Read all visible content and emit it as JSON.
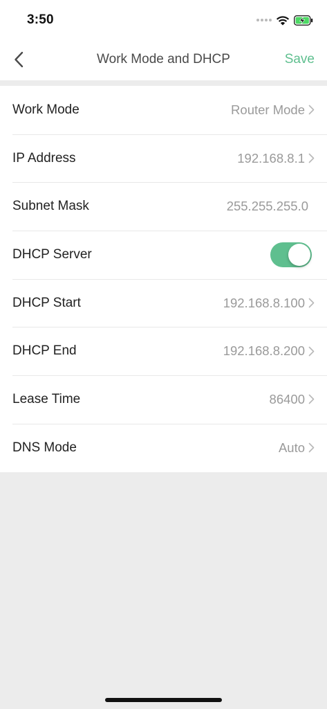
{
  "status_bar": {
    "time": "3:50"
  },
  "nav": {
    "title": "Work Mode and DHCP",
    "save_label": "Save"
  },
  "colors": {
    "accent": "#5fbf8f",
    "toggle_on": "#5fbf8f",
    "battery": "#4cd964"
  },
  "rows": [
    {
      "label": "Work Mode",
      "value": "Router Mode",
      "chevron": true
    },
    {
      "label": "IP Address",
      "value": "192.168.8.1",
      "chevron": true
    },
    {
      "label": "Subnet Mask",
      "value": "255.255.255.0",
      "chevron": false
    },
    {
      "label": "DHCP Server",
      "toggle_on": true
    },
    {
      "label": "DHCP Start",
      "value": "192.168.8.100",
      "chevron": true
    },
    {
      "label": "DHCP End",
      "value": "192.168.8.200",
      "chevron": true
    },
    {
      "label": "Lease Time",
      "value": "86400",
      "chevron": true
    },
    {
      "label": "DNS Mode",
      "value": "Auto",
      "chevron": true
    }
  ]
}
